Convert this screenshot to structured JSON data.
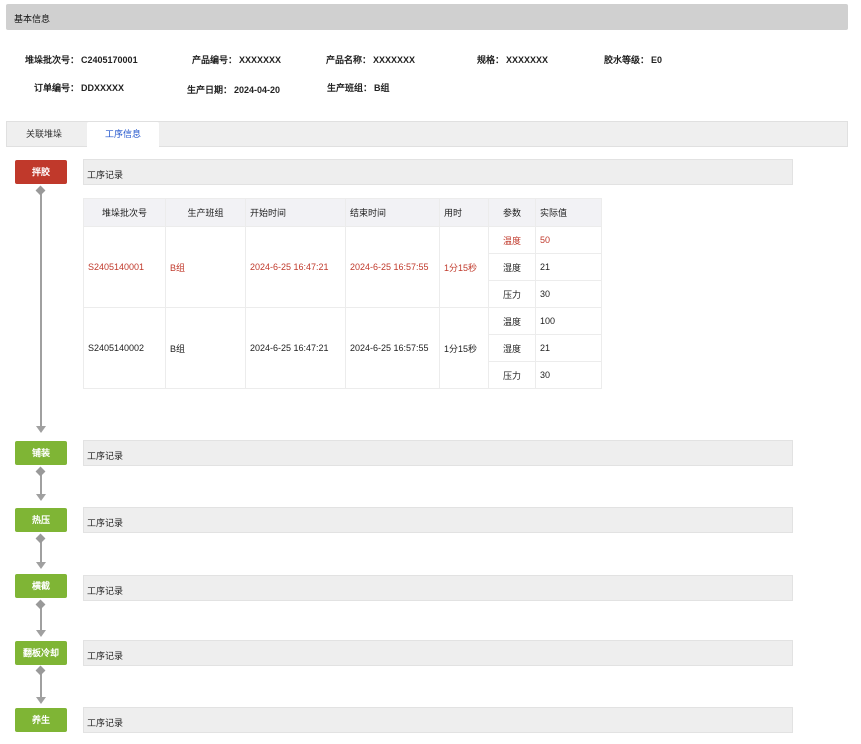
{
  "section": {
    "title": "基本信息"
  },
  "info": {
    "batch_label": "堆垛批次号：",
    "batch_value": "C2405170001",
    "product_code_label": "产品编号：",
    "product_code_value": "XXXXXXX",
    "product_name_label": "产品名称：",
    "product_name_value": "XXXXXXX",
    "spec_label": "规格：",
    "spec_value": "XXXXXXX",
    "glue_grade_label": "胶水等级：",
    "glue_grade_value": "E0",
    "order_label": "订单编号：",
    "order_value": "DDXXXXX",
    "date_label": "生产日期：",
    "date_value": "2024-04-20",
    "team_label": "生产班组：",
    "team_value": "B组"
  },
  "tabs": [
    {
      "label": "关联堆垛",
      "active": false
    },
    {
      "label": "工序信息",
      "active": true
    }
  ],
  "steps": [
    {
      "label": "拌胶",
      "record": "工序记录",
      "color": "#c0392b"
    },
    {
      "label": "铺装",
      "record": "工序记录",
      "color": "#7fb535"
    },
    {
      "label": "热压",
      "record": "工序记录",
      "color": "#7fb535"
    },
    {
      "label": "横截",
      "record": "工序记录",
      "color": "#7fb535"
    },
    {
      "label": "翻板冷却",
      "record": "工序记录",
      "color": "#7fb535"
    },
    {
      "label": "养生",
      "record": "工序记录",
      "color": "#7fb535"
    }
  ],
  "table": {
    "headers": [
      "堆垛批次号",
      "生产班组",
      "开始时间",
      "结束时间",
      "用时",
      "参数",
      "实际值"
    ],
    "rows": [
      {
        "batch": "S2405140001",
        "team": "B组",
        "start": "2024-6-25 16:47:21",
        "end": "2024-6-25 16:57:55",
        "duration": "1分15秒",
        "params": [
          {
            "name": "温度",
            "value": "50"
          },
          {
            "name": "湿度",
            "value": "21"
          },
          {
            "name": "压力",
            "value": "30"
          }
        ]
      },
      {
        "batch": "S2405140002",
        "team": "B组",
        "start": "2024-6-25 16:47:21",
        "end": "2024-6-25 16:57:55",
        "duration": "1分15秒",
        "params": [
          {
            "name": "温度",
            "value": "100"
          },
          {
            "name": "湿度",
            "value": "21"
          },
          {
            "name": "压力",
            "value": "30"
          }
        ]
      }
    ]
  },
  "colors": {
    "accent_red": "#c0392b",
    "accent_green": "#7fb535",
    "tab_active": "#2255cc"
  }
}
